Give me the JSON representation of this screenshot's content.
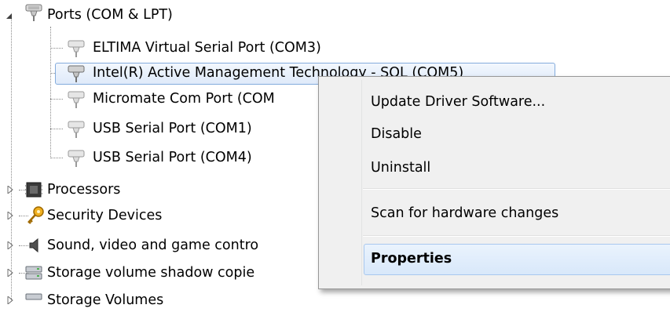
{
  "tree": {
    "ports_category": "Ports (COM & LPT)",
    "ports": [
      "ELTIMA Virtual Serial Port (COM3)",
      "Intel(R) Active Management Technology - SOL (COM5)",
      "Micromate Com Port (COM",
      "USB Serial Port (COM1)",
      "USB Serial Port (COM4)"
    ],
    "categories": [
      "Processors",
      "Security Devices",
      "Sound, video and game contro",
      "Storage volume shadow copie",
      "Storage Volumes"
    ],
    "selected_item": "Intel(R) Active Management Technology - SOL (COM5)"
  },
  "context_menu": {
    "items": [
      "Update Driver Software...",
      "Disable",
      "Uninstall",
      "Scan for hardware changes",
      "Properties"
    ],
    "highlighted": "Properties",
    "default_bold": "Properties"
  },
  "colors": {
    "selection_border": "#84acdd",
    "menu_background": "#f0f0f0",
    "menu_highlight_border": "#a8c8ef"
  }
}
